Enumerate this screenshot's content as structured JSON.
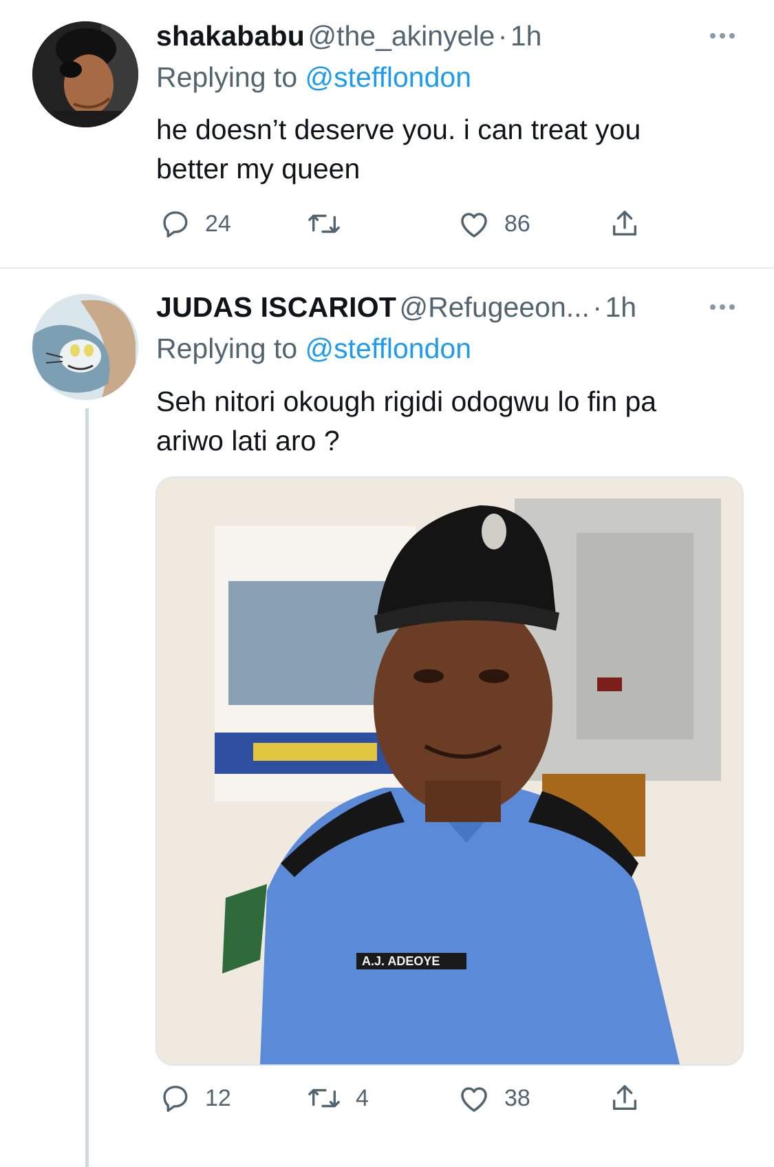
{
  "tweets": [
    {
      "display_name": "shakababu",
      "handle": "@the_akinyele",
      "sep": "·",
      "time": "1h",
      "replying_prefix": "Replying to ",
      "replying_to": "@stefflondon",
      "text_lines": [
        "he doesn’t deserve you. i can treat you",
        "better my queen"
      ],
      "reply_count": "24",
      "retweet_count": "",
      "like_count": "86"
    },
    {
      "display_name": "JUDAS ISCARIOT",
      "handle": "@Refugeeon...",
      "sep": "·",
      "time": "1h",
      "replying_prefix": "Replying to ",
      "replying_to": "@stefflondon",
      "text_lines": [
        "Seh nitori okough rigidi odogwu lo fin pa",
        "ariwo lati aro ?"
      ],
      "photo_nameplate": "A.J. ADEOYE",
      "reply_count": "12",
      "retweet_count": "4",
      "like_count": "38"
    }
  ],
  "colors": {
    "accent": "#1d9bf0",
    "muted": "#536471",
    "text": "#0f1419"
  }
}
